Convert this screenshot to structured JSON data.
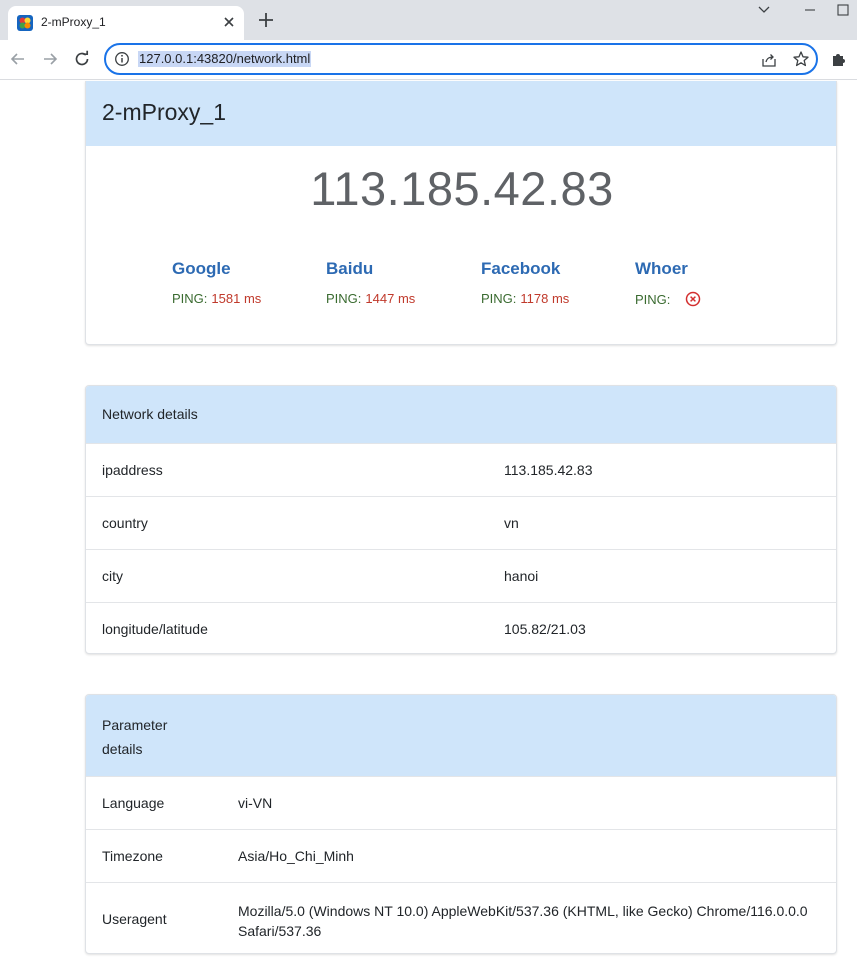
{
  "browser": {
    "tab_title": "2-mProxy_1",
    "url": "127.0.0.1:43820/network.html"
  },
  "proxy": {
    "name": "2-mProxy_1",
    "ip": "113.185.42.83",
    "ping_label": "PING:",
    "sites": [
      {
        "name": "Google",
        "ping": "1581 ms"
      },
      {
        "name": "Baidu",
        "ping": "1447 ms"
      },
      {
        "name": "Facebook",
        "ping": "1178 ms"
      },
      {
        "name": "Whoer",
        "ping": "",
        "status": "failed"
      }
    ]
  },
  "network": {
    "title": "Network details",
    "rows": [
      {
        "key": "ipaddress",
        "value": "113.185.42.83"
      },
      {
        "key": "country",
        "value": "vn"
      },
      {
        "key": "city",
        "value": "hanoi"
      },
      {
        "key": "longitude/latitude",
        "value": "105.82/21.03"
      }
    ]
  },
  "parameters": {
    "title": "Parameter details",
    "rows": [
      {
        "key": "Language",
        "value": "vi-VN"
      },
      {
        "key": "Timezone",
        "value": "Asia/Ho_Chi_Minh"
      },
      {
        "key": "Useragent",
        "value": "Mozilla/5.0 (Windows NT 10.0) AppleWebKit/537.36 (KHTML, like Gecko) Chrome/116.0.0.0 Safari/537.36"
      }
    ]
  },
  "colors": {
    "header_bg": "#cfe5fa",
    "site_link": "#2d6ab3",
    "ping_label": "#3a6b30",
    "ping_value": "#c0392b",
    "omnibox_focus": "#1a73e8"
  },
  "icons": [
    "favicon-icon",
    "close-icon",
    "plus-icon",
    "chevron-down-icon",
    "minimize-icon",
    "maximize-icon",
    "back-arrow-icon",
    "forward-arrow-icon",
    "reload-icon",
    "info-icon",
    "share-icon",
    "star-icon",
    "puzzle-icon",
    "fail-circle-x-icon"
  ]
}
